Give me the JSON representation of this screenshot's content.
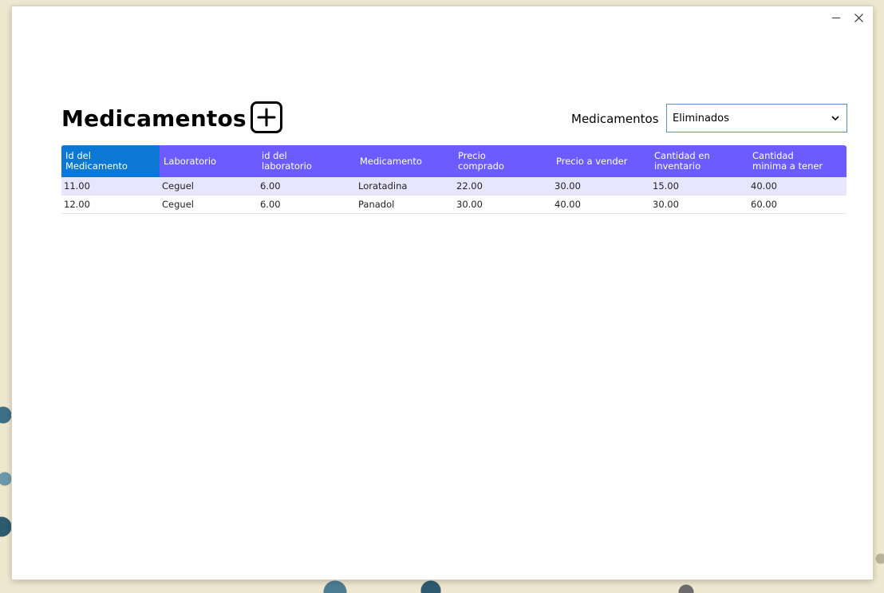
{
  "window": {
    "minimize_label": "",
    "close_label": "✕"
  },
  "header": {
    "title": "Medicamentos",
    "add_icon": "plus-square-icon"
  },
  "filter": {
    "label": "Medicamentos",
    "selected": "Eliminados",
    "chevron_icon": "chevron-down-icon"
  },
  "table": {
    "columns": [
      "Id del\nMedicamento",
      "Laboratorio",
      "id del\nlaboratorio",
      "Medicamento",
      "Precio\ncomprado",
      "Precio a vender",
      "Cantidad en\ninventario",
      "Cantidad\nminima a tener"
    ],
    "rows": [
      [
        "11.00",
        "Ceguel",
        "6.00",
        "Loratadina",
        "22.00",
        "30.00",
        "15.00",
        "40.00"
      ],
      [
        "12.00",
        "Ceguel",
        "6.00",
        "Panadol",
        "30.00",
        "40.00",
        "30.00",
        "60.00"
      ]
    ]
  },
  "colors": {
    "header_bg": "#6a5cff",
    "header_active_bg": "#0a78d4",
    "row_alt_bg": "#e8e6ff",
    "select_border": "#5b8fc9"
  }
}
